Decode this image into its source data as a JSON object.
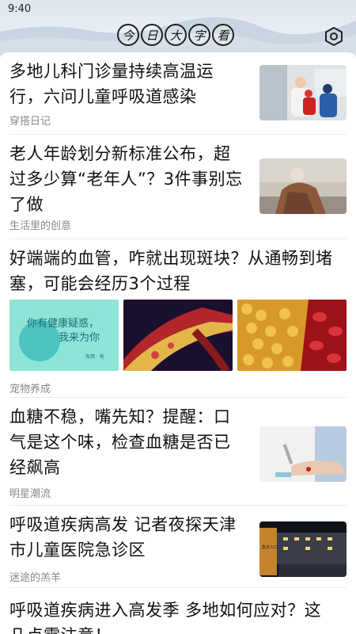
{
  "status_bar": {
    "time": "9:40"
  },
  "header": {
    "logo_chars": [
      "今",
      "日",
      "大",
      "字",
      "看"
    ],
    "settings_icon": "gear-hexagon-icon"
  },
  "feed": [
    {
      "title": "多地儿科门诊量持续高温运行，六问儿童呼吸道感染",
      "source": "穿搭日记",
      "thumb": "pediatric-clinic-photo"
    },
    {
      "title": "老人年龄划分新标准公布，超过多少算“老年人”？3件事别忘了做",
      "source": "生活里的创意",
      "thumb": "elderly-woman-photo"
    },
    {
      "title": "好端端的血管，咋就出现斑块？从通畅到堵塞，可能会经历3个过程",
      "source": "宠物养成",
      "images": [
        {
          "kind": "promo-banner",
          "text_line1": "你有健康疑惑，",
          "text_line2": "我来为你",
          "footer": "有用 · 有"
        },
        {
          "kind": "blood-vessel-plaque-illustration"
        },
        {
          "kind": "fat-cells-blood-illustration"
        }
      ]
    },
    {
      "title": "血糖不稳，嘴先知？提醒：口气是这个味，检查血糖是否已经飙高",
      "source": "明星潮流",
      "thumb": "glucose-test-photo"
    },
    {
      "title": "呼吸道疾病高发 记者夜探天津市儿童医院急诊区",
      "source": "迷途的羔羊",
      "thumb": "emergency-entrance-photo",
      "thumb_sign": "急诊入口"
    },
    {
      "title": "呼吸道疾病进入高发季 多地如何应对？这",
      "title_line2": "几点需注意！"
    }
  ]
}
